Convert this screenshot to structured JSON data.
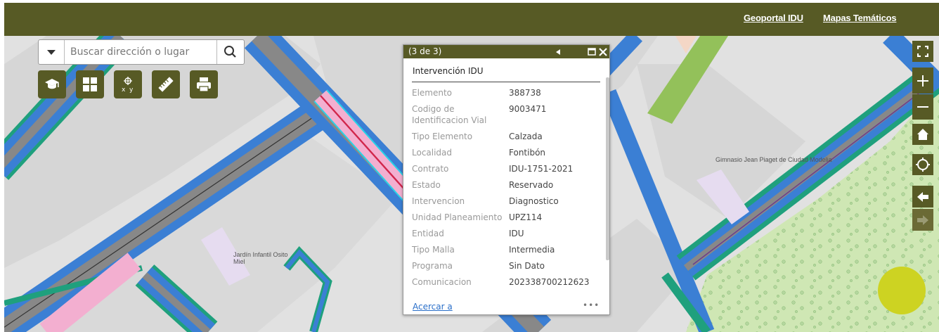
{
  "header": {
    "links": [
      "Geoportal IDU",
      "Mapas Temáticos"
    ],
    "bg_color": "#575a25"
  },
  "search": {
    "placeholder": "Buscar dirección o lugar",
    "dropdown_icon": "caret-down-icon",
    "button_icon": "search-icon"
  },
  "toolbar": {
    "tools": [
      "graduation-cap-icon",
      "grid-icon",
      "xy-coordinates-icon",
      "ruler-icon",
      "printer-icon"
    ]
  },
  "map_controls": [
    "fullscreen-icon",
    "zoom-in-icon",
    "zoom-out-icon",
    "home-icon",
    "locate-icon",
    "back-icon",
    "forward-icon"
  ],
  "map_labels": [
    "Gimnasio Jean Piaget de Ciudad Modelia",
    "Jardín Infantil Osito Miel"
  ],
  "popup": {
    "counter": "(3 de 3)",
    "title": "Intervención IDU",
    "fields": [
      {
        "key": "Elemento",
        "value": "388738"
      },
      {
        "key": "Codigo de Identificacion Vial",
        "value": "9003471"
      },
      {
        "key": "Tipo Elemento",
        "value": "Calzada"
      },
      {
        "key": "Localidad",
        "value": "Fontibón"
      },
      {
        "key": "Contrato",
        "value": "IDU-1751-2021"
      },
      {
        "key": "Estado",
        "value": "Reservado"
      },
      {
        "key": "Intervencion",
        "value": "Diagnostico"
      },
      {
        "key": "Unidad Planeamiento",
        "value": "UPZ114"
      },
      {
        "key": "Entidad",
        "value": "IDU"
      },
      {
        "key": "Tipo Malla",
        "value": "Intermedia"
      },
      {
        "key": "Programa",
        "value": "Sin Dato"
      },
      {
        "key": "Comunicacion",
        "value": "202338700212623"
      }
    ],
    "zoom_link": "Acercar a",
    "more": "•••"
  }
}
